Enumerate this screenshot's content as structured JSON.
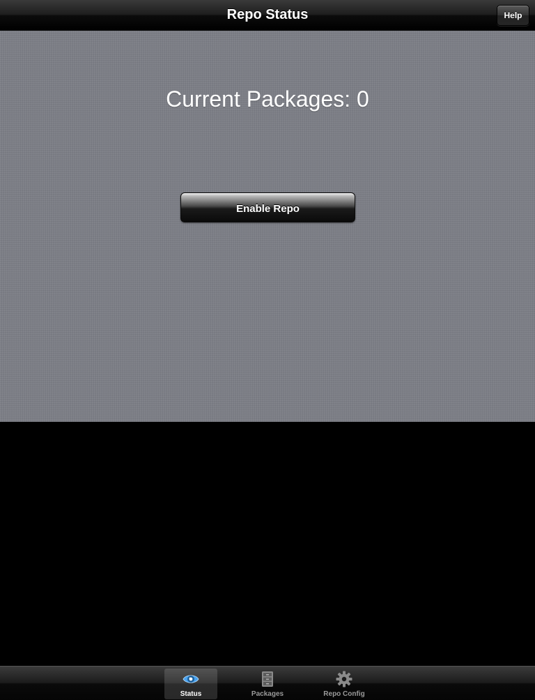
{
  "nav_bar": {
    "title": "Repo Status",
    "help_label": "Help"
  },
  "content": {
    "packages_text": "Current Packages: 0",
    "enable_button_label": "Enable Repo"
  },
  "tab_bar": {
    "tabs": [
      {
        "label": "Status",
        "icon": "eye-icon",
        "selected": true
      },
      {
        "label": "Packages",
        "icon": "cabinet-icon",
        "selected": false
      },
      {
        "label": "Repo Config",
        "icon": "gear-icon",
        "selected": false
      }
    ]
  },
  "colors": {
    "selected_tab_icon": "#4aa3f0",
    "unselected_tab_icon": "#8a8a8a",
    "content_background": "#7a7c84"
  }
}
